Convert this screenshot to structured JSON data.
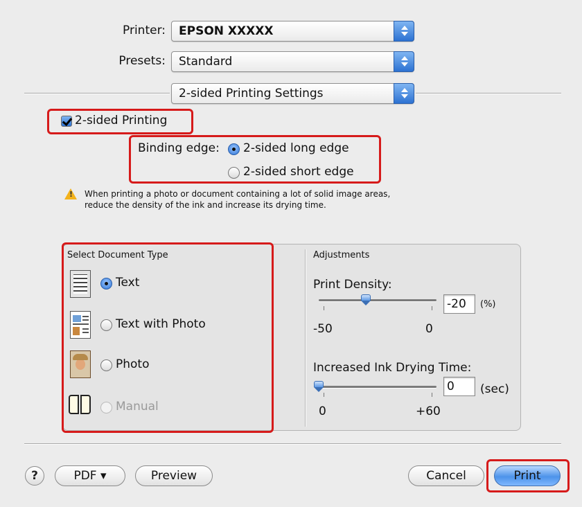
{
  "printer": {
    "label": "Printer:",
    "value": "EPSON XXXXX"
  },
  "presets": {
    "label": "Presets:",
    "value": "Standard"
  },
  "panel_menu": {
    "value": "2-sided Printing Settings"
  },
  "two_sided": {
    "label": "2-sided Printing",
    "checked": true
  },
  "binding": {
    "label": "Binding edge:",
    "options": [
      {
        "label": "2-sided long edge",
        "selected": true
      },
      {
        "label": "2-sided short edge",
        "selected": false
      }
    ]
  },
  "warning": {
    "line1": "When printing a photo or document containing a lot of solid image areas,",
    "line2": "reduce the density of the ink and increase its drying time."
  },
  "document_type": {
    "title": "Select Document Type",
    "options": [
      {
        "label": "Text",
        "icon": "text-document-icon",
        "selected": true,
        "enabled": true
      },
      {
        "label": "Text with Photo",
        "icon": "text-photo-document-icon",
        "selected": false,
        "enabled": true
      },
      {
        "label": "Photo",
        "icon": "photo-document-icon",
        "selected": false,
        "enabled": true
      },
      {
        "label": "Manual",
        "icon": "manual-book-icon",
        "selected": false,
        "enabled": false
      }
    ]
  },
  "adjustments": {
    "title": "Adjustments",
    "density": {
      "label": "Print Density:",
      "value": "-20",
      "unit": "(%)",
      "min_label": "-50",
      "mid_label": "0",
      "min": -50,
      "max": 0,
      "current": -20
    },
    "drying": {
      "label": "Increased Ink Drying Time:",
      "value": "0",
      "unit": "(sec)",
      "min_label": "0",
      "max_label": "+60",
      "min": 0,
      "max": 60,
      "current": 0
    }
  },
  "buttons": {
    "help": "?",
    "pdf": "PDF ▾",
    "preview": "Preview",
    "cancel": "Cancel",
    "print": "Print"
  },
  "colors": {
    "highlight": "#d61a1a",
    "accent": "#2d72d2"
  }
}
